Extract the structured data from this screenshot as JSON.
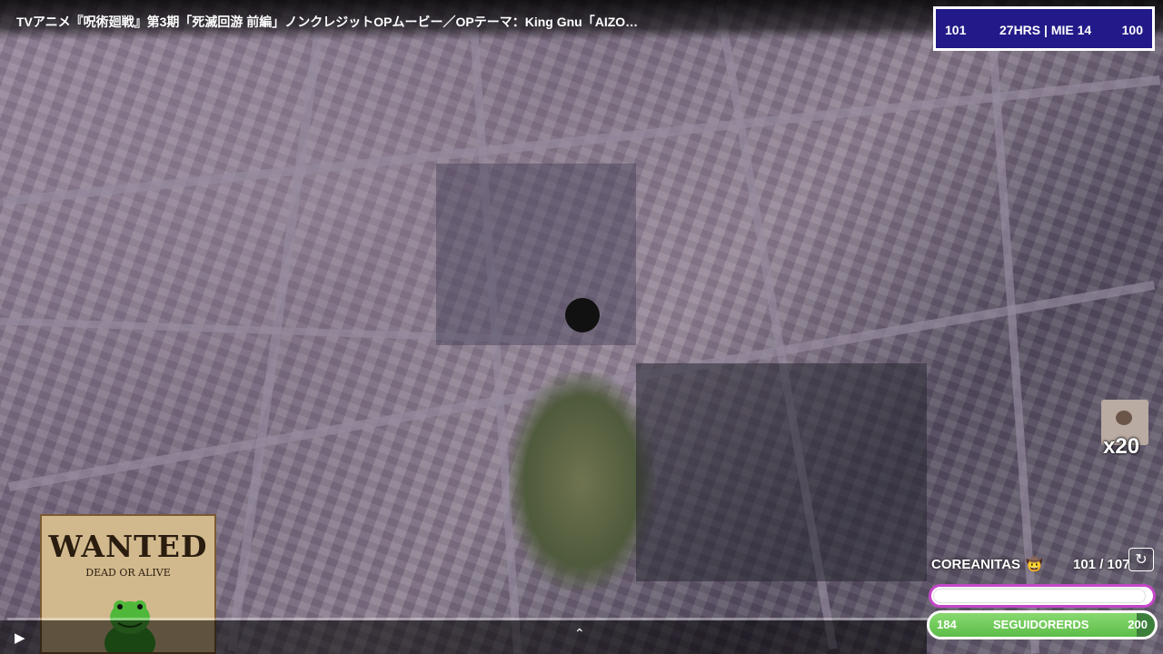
{
  "video": {
    "title": "TVアニメ『呪術廻戦』第3期「死滅回游 前編」ノンクレジットOPムービー／OPテーマ：King Gnu「AIZO…",
    "progress_fraction": 0.0
  },
  "stats": {
    "left": "101",
    "middle": "27HRS | MIE 14",
    "right": "100"
  },
  "overlay": {
    "multiplier": "x20",
    "poster_title": "WANTED",
    "poster_subtitle": "DEAD OR ALIVE",
    "counter_label": "COREANITAS",
    "counter_emoji": "🤠",
    "counter_value": "101  /  107"
  },
  "follower_goal": {
    "current": "184",
    "label": "SEGUIDORERDS",
    "goal": "200",
    "fill_fraction": 0.92
  },
  "controls": {
    "play_icon": "▶",
    "expand_icon": "⌃",
    "refresh_icon": "↻"
  },
  "colors": {
    "stats_bg": "#221a88",
    "progress": "#e6007a",
    "goal_fill": "#5dbd49",
    "bar_border": "#c447c8"
  }
}
